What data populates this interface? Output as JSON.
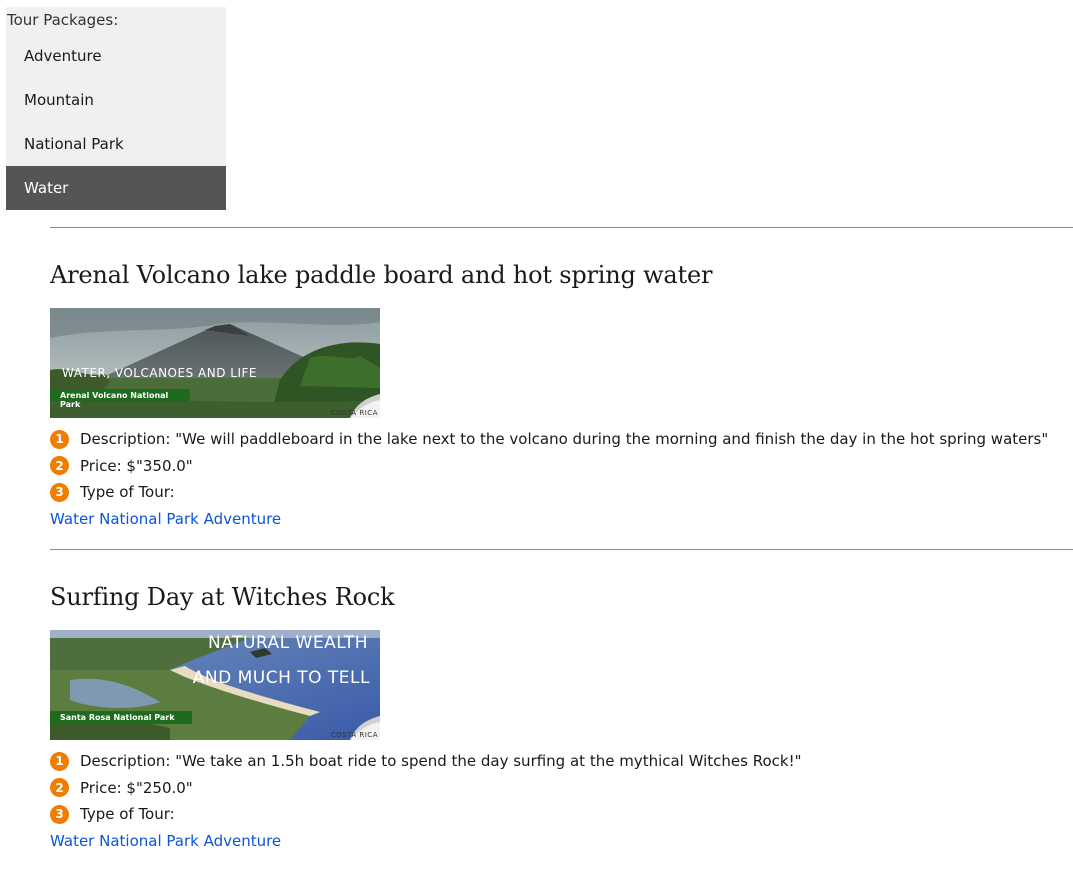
{
  "menu": {
    "title": "Tour Packages:",
    "items": [
      {
        "label": "Adventure",
        "active": false
      },
      {
        "label": "Mountain",
        "active": false
      },
      {
        "label": "National Park",
        "active": false
      },
      {
        "label": "Water",
        "active": true
      }
    ]
  },
  "colors": {
    "active_bg": "#555555",
    "menu_bg": "#f0f0f0",
    "badge": "#f07c00",
    "link": "#0a55d8",
    "banner_green": "#1e6b1e"
  },
  "tours": [
    {
      "title": "Arenal Volcano lake paddle board and hot spring water",
      "banner": {
        "caption_line1": "Water, volcanoes and life",
        "caption_line2": "",
        "park": "Arenal Volcano National Park",
        "country": "COSTA RICA"
      },
      "details": [
        {
          "num": "1",
          "text": "Description: \"We will paddleboard in the lake next to the volcano during the morning and finish the day in the hot spring waters\""
        },
        {
          "num": "2",
          "text": "Price: $\"350.0\""
        },
        {
          "num": "3",
          "text": "Type of Tour:"
        }
      ],
      "link": "Water National Park Adventure"
    },
    {
      "title": "Surfing Day at Witches Rock",
      "banner": {
        "caption_line1": "Natural wealth",
        "caption_line2": "and much to tell",
        "park": "Santa Rosa National Park",
        "country": "COSTA RICA"
      },
      "details": [
        {
          "num": "1",
          "text": "Description: \"We take an 1.5h boat ride to spend the day surfing at the mythical Witches Rock!\""
        },
        {
          "num": "2",
          "text": "Price: $\"250.0\""
        },
        {
          "num": "3",
          "text": "Type of Tour:"
        }
      ],
      "link": "Water National Park Adventure"
    }
  ]
}
